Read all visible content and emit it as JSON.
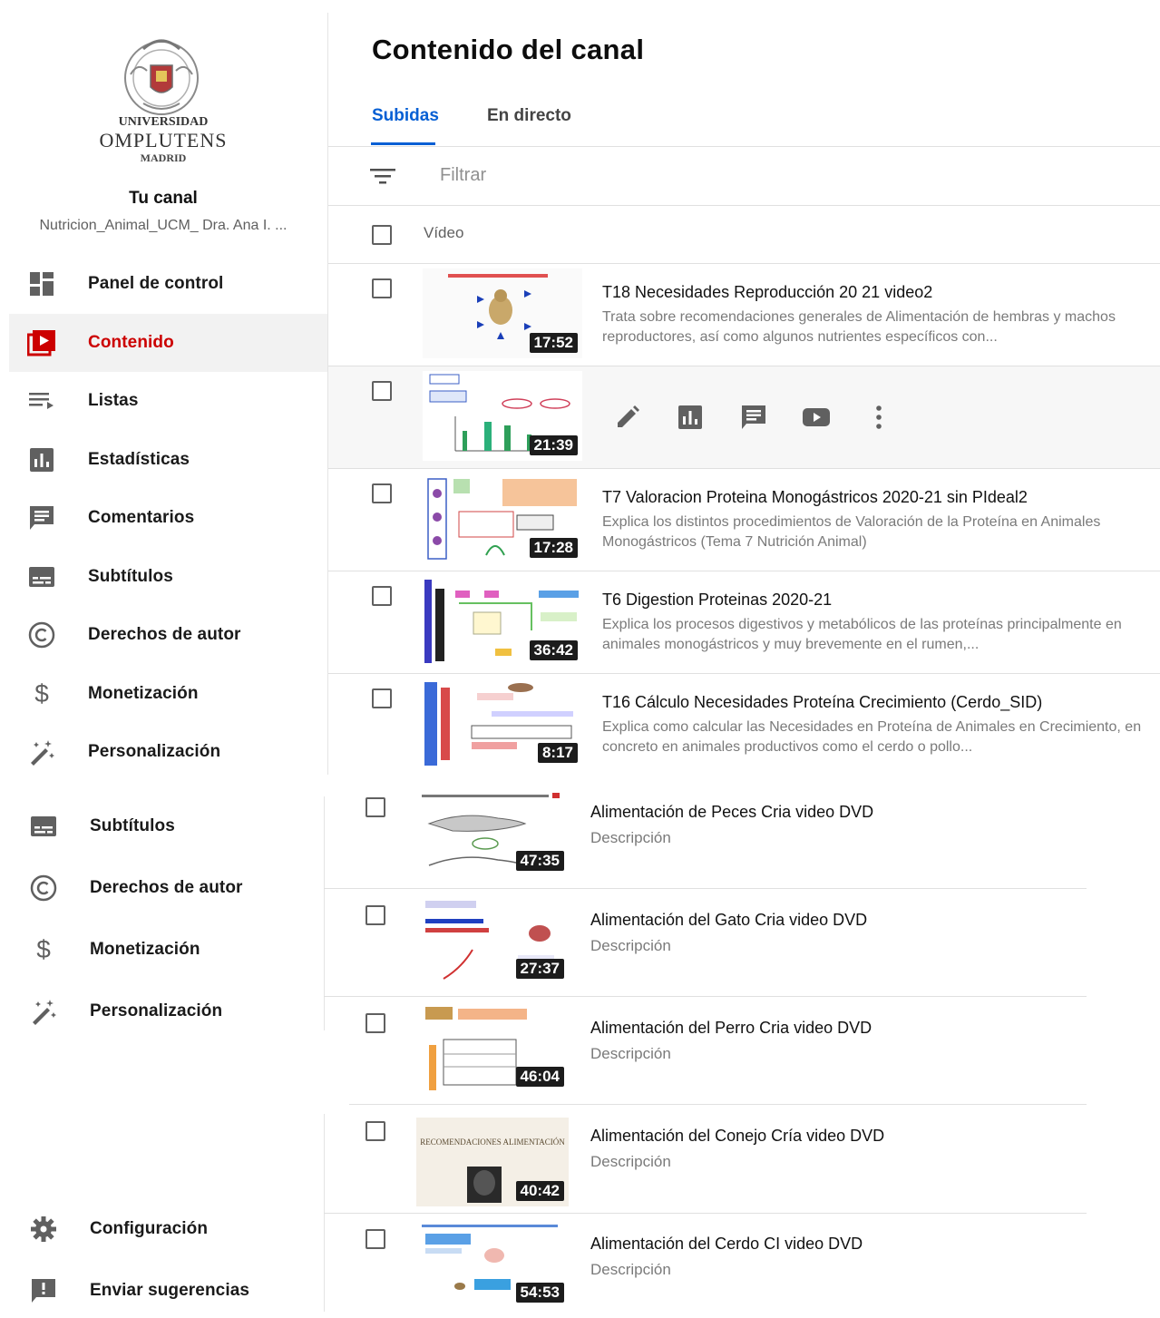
{
  "university": {
    "line1": "UNIVERSIDAD",
    "line2": "OMPLUTENS",
    "line3": "MADRID"
  },
  "channel": {
    "heading": "Tu canal",
    "name": "Nutricion_Animal_UCM_ Dra. Ana I. ..."
  },
  "sidebar": {
    "items": [
      {
        "label": "Panel de control",
        "icon": "dashboard-icon"
      },
      {
        "label": "Contenido",
        "icon": "content-icon"
      },
      {
        "label": "Listas",
        "icon": "playlist-icon"
      },
      {
        "label": "Estadísticas",
        "icon": "analytics-icon"
      },
      {
        "label": "Comentarios",
        "icon": "comments-icon"
      },
      {
        "label": "Subtítulos",
        "icon": "subtitles-icon"
      },
      {
        "label": "Derechos de autor",
        "icon": "copyright-icon"
      },
      {
        "label": "Monetización",
        "icon": "dollar-icon"
      },
      {
        "label": "Personalización",
        "icon": "magic-wand-icon"
      }
    ],
    "items_repeat": [
      {
        "label": "Subtítulos",
        "icon": "subtitles-icon"
      },
      {
        "label": "Derechos de autor",
        "icon": "copyright-icon"
      },
      {
        "label": "Monetización",
        "icon": "dollar-icon"
      },
      {
        "label": "Personalización",
        "icon": "magic-wand-icon"
      }
    ],
    "footer": [
      {
        "label": "Configuración",
        "icon": "gear-icon"
      },
      {
        "label": "Enviar sugerencias",
        "icon": "feedback-icon"
      }
    ]
  },
  "main": {
    "title": "Contenido del canal",
    "tabs": [
      {
        "label": "Subidas",
        "active": true
      },
      {
        "label": "En directo",
        "active": false
      }
    ],
    "filter_placeholder": "Filtrar",
    "column_header": "Vídeo",
    "accent": "#065fd4",
    "videos": [
      {
        "title": "T18 Necesidades Reproducción 20 21 video2",
        "description": "Trata sobre recomendaciones generales de Alimentación de hembras y machos reproductores, así como algunos nutrientes específicos con...",
        "duration": "17:52"
      },
      {
        "title": "",
        "description": "",
        "duration": "21:39"
      },
      {
        "title": "T7 Valoracion Proteina Monogástricos 2020-21 sin PIdeal2",
        "description": "Explica los distintos procedimientos de Valoración de la Proteína en Animales Monogástricos (Tema 7 Nutrición Animal)",
        "duration": "17:28"
      },
      {
        "title": "T6 Digestion Proteinas 2020-21",
        "description": "Explica los procesos digestivos y metabólicos de las proteínas principalmente en animales monogástricos y muy brevemente en el rumen,...",
        "duration": "36:42"
      },
      {
        "title": "T16 Cálculo Necesidades Proteína Crecimiento (Cerdo_SID)",
        "description": "Explica como calcular las Necesidades en Proteína de Animales en Crecimiento, en concreto en animales productivos como el cerdo o pollo...",
        "duration": "8:17"
      },
      {
        "title": "Alimentación de Peces Cria video DVD",
        "description": "Descripción",
        "duration": "47:35"
      },
      {
        "title": "Alimentación del Gato Cria video DVD",
        "description": "Descripción",
        "duration": "27:37"
      },
      {
        "title": "Alimentación del Perro Cria video DVD",
        "description": "Descripción",
        "duration": "46:04"
      },
      {
        "title": "Alimentación del Conejo Cría video DVD",
        "description": "Descripción",
        "duration": "40:42"
      },
      {
        "title": "Alimentación del Cerdo CI video DVD",
        "description": "Descripción",
        "duration": "54:53"
      }
    ],
    "thumb_text_conejo": "RECOMENDACIONES ALIMENTACIÓN"
  }
}
